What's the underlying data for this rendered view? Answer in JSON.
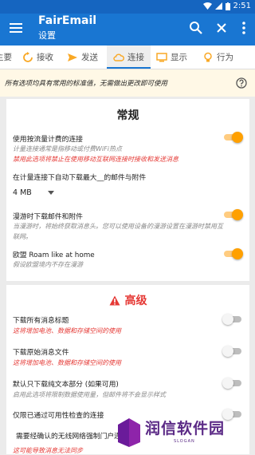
{
  "status": {
    "time": "2:51"
  },
  "appbar": {
    "title": "FairEmail",
    "subtitle": "设置"
  },
  "tabs": [
    {
      "label": "主要"
    },
    {
      "label": "接收"
    },
    {
      "label": "发送"
    },
    {
      "label": "连接"
    },
    {
      "label": "显示"
    },
    {
      "label": "行为"
    }
  ],
  "notice": {
    "text": "所有选项均具有常用的标准值，无需做出更改即可使用"
  },
  "general": {
    "title": "常规",
    "metered": {
      "label": "使用按流量计费的连接",
      "hint": "计量连接通常是指移动或付费WiFi热点",
      "warning": "禁用此选项将禁止在使用移动互联网连接时接收和发送消息",
      "on": true
    },
    "autodl": {
      "label": "在计量连接下自动下载最大__的邮件与附件",
      "value": "4 MB"
    },
    "roaming": {
      "label": "漫游时下载邮件和附件",
      "hint": "当漫游时，将始终获取消息头。您可以使用设备的漫游设置在漫游时禁用互联网。",
      "on": true
    },
    "eu_roaming": {
      "label": "欧盟 Roam like at home",
      "hint": "假设欧盟境内不存在漫游",
      "on": true
    }
  },
  "advanced": {
    "title": "高级",
    "dl_headers": {
      "label": "下载所有消息标题",
      "warning": "这将增加电池、数据和存储空间的使用",
      "on": false
    },
    "dl_eml": {
      "label": "下载原始消息文件",
      "warning": "这将增加电池、数据和存储空间的使用",
      "on": false
    },
    "dl_plain": {
      "label": "默认只下载纯文本部分 (如果可用)",
      "hint": "启用此选项将限制数据使用量，但邮件将不会显示样式",
      "on": false
    },
    "validated": {
      "label": "仅限已通过可用性检查的连接",
      "on": false
    },
    "require_validated": {
      "label": "需要经确认的无线网络强制门户连接",
      "warning": "这可能导致消息无法同步"
    }
  },
  "watermark": {
    "text": "润信软件园",
    "slogan": "SLOGAN"
  }
}
